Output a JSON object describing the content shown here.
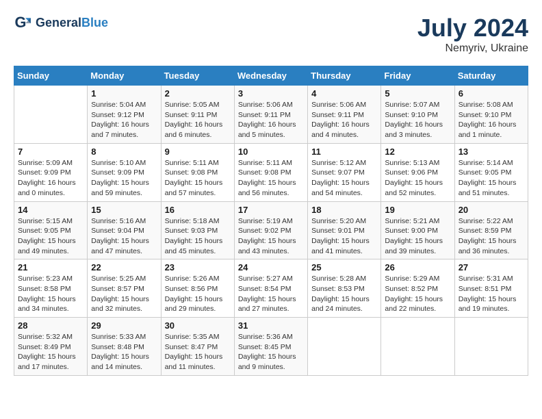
{
  "header": {
    "logo_line1": "General",
    "logo_line2": "Blue",
    "month_year": "July 2024",
    "location": "Nemyriv, Ukraine"
  },
  "days_of_week": [
    "Sunday",
    "Monday",
    "Tuesday",
    "Wednesday",
    "Thursday",
    "Friday",
    "Saturday"
  ],
  "weeks": [
    [
      {
        "day": "",
        "info": ""
      },
      {
        "day": "1",
        "info": "Sunrise: 5:04 AM\nSunset: 9:12 PM\nDaylight: 16 hours\nand 7 minutes."
      },
      {
        "day": "2",
        "info": "Sunrise: 5:05 AM\nSunset: 9:11 PM\nDaylight: 16 hours\nand 6 minutes."
      },
      {
        "day": "3",
        "info": "Sunrise: 5:06 AM\nSunset: 9:11 PM\nDaylight: 16 hours\nand 5 minutes."
      },
      {
        "day": "4",
        "info": "Sunrise: 5:06 AM\nSunset: 9:11 PM\nDaylight: 16 hours\nand 4 minutes."
      },
      {
        "day": "5",
        "info": "Sunrise: 5:07 AM\nSunset: 9:10 PM\nDaylight: 16 hours\nand 3 minutes."
      },
      {
        "day": "6",
        "info": "Sunrise: 5:08 AM\nSunset: 9:10 PM\nDaylight: 16 hours\nand 1 minute."
      }
    ],
    [
      {
        "day": "7",
        "info": "Sunrise: 5:09 AM\nSunset: 9:09 PM\nDaylight: 16 hours\nand 0 minutes."
      },
      {
        "day": "8",
        "info": "Sunrise: 5:10 AM\nSunset: 9:09 PM\nDaylight: 15 hours\nand 59 minutes."
      },
      {
        "day": "9",
        "info": "Sunrise: 5:11 AM\nSunset: 9:08 PM\nDaylight: 15 hours\nand 57 minutes."
      },
      {
        "day": "10",
        "info": "Sunrise: 5:11 AM\nSunset: 9:08 PM\nDaylight: 15 hours\nand 56 minutes."
      },
      {
        "day": "11",
        "info": "Sunrise: 5:12 AM\nSunset: 9:07 PM\nDaylight: 15 hours\nand 54 minutes."
      },
      {
        "day": "12",
        "info": "Sunrise: 5:13 AM\nSunset: 9:06 PM\nDaylight: 15 hours\nand 52 minutes."
      },
      {
        "day": "13",
        "info": "Sunrise: 5:14 AM\nSunset: 9:05 PM\nDaylight: 15 hours\nand 51 minutes."
      }
    ],
    [
      {
        "day": "14",
        "info": "Sunrise: 5:15 AM\nSunset: 9:05 PM\nDaylight: 15 hours\nand 49 minutes."
      },
      {
        "day": "15",
        "info": "Sunrise: 5:16 AM\nSunset: 9:04 PM\nDaylight: 15 hours\nand 47 minutes."
      },
      {
        "day": "16",
        "info": "Sunrise: 5:18 AM\nSunset: 9:03 PM\nDaylight: 15 hours\nand 45 minutes."
      },
      {
        "day": "17",
        "info": "Sunrise: 5:19 AM\nSunset: 9:02 PM\nDaylight: 15 hours\nand 43 minutes."
      },
      {
        "day": "18",
        "info": "Sunrise: 5:20 AM\nSunset: 9:01 PM\nDaylight: 15 hours\nand 41 minutes."
      },
      {
        "day": "19",
        "info": "Sunrise: 5:21 AM\nSunset: 9:00 PM\nDaylight: 15 hours\nand 39 minutes."
      },
      {
        "day": "20",
        "info": "Sunrise: 5:22 AM\nSunset: 8:59 PM\nDaylight: 15 hours\nand 36 minutes."
      }
    ],
    [
      {
        "day": "21",
        "info": "Sunrise: 5:23 AM\nSunset: 8:58 PM\nDaylight: 15 hours\nand 34 minutes."
      },
      {
        "day": "22",
        "info": "Sunrise: 5:25 AM\nSunset: 8:57 PM\nDaylight: 15 hours\nand 32 minutes."
      },
      {
        "day": "23",
        "info": "Sunrise: 5:26 AM\nSunset: 8:56 PM\nDaylight: 15 hours\nand 29 minutes."
      },
      {
        "day": "24",
        "info": "Sunrise: 5:27 AM\nSunset: 8:54 PM\nDaylight: 15 hours\nand 27 minutes."
      },
      {
        "day": "25",
        "info": "Sunrise: 5:28 AM\nSunset: 8:53 PM\nDaylight: 15 hours\nand 24 minutes."
      },
      {
        "day": "26",
        "info": "Sunrise: 5:29 AM\nSunset: 8:52 PM\nDaylight: 15 hours\nand 22 minutes."
      },
      {
        "day": "27",
        "info": "Sunrise: 5:31 AM\nSunset: 8:51 PM\nDaylight: 15 hours\nand 19 minutes."
      }
    ],
    [
      {
        "day": "28",
        "info": "Sunrise: 5:32 AM\nSunset: 8:49 PM\nDaylight: 15 hours\nand 17 minutes."
      },
      {
        "day": "29",
        "info": "Sunrise: 5:33 AM\nSunset: 8:48 PM\nDaylight: 15 hours\nand 14 minutes."
      },
      {
        "day": "30",
        "info": "Sunrise: 5:35 AM\nSunset: 8:47 PM\nDaylight: 15 hours\nand 11 minutes."
      },
      {
        "day": "31",
        "info": "Sunrise: 5:36 AM\nSunset: 8:45 PM\nDaylight: 15 hours\nand 9 minutes."
      },
      {
        "day": "",
        "info": ""
      },
      {
        "day": "",
        "info": ""
      },
      {
        "day": "",
        "info": ""
      }
    ]
  ]
}
